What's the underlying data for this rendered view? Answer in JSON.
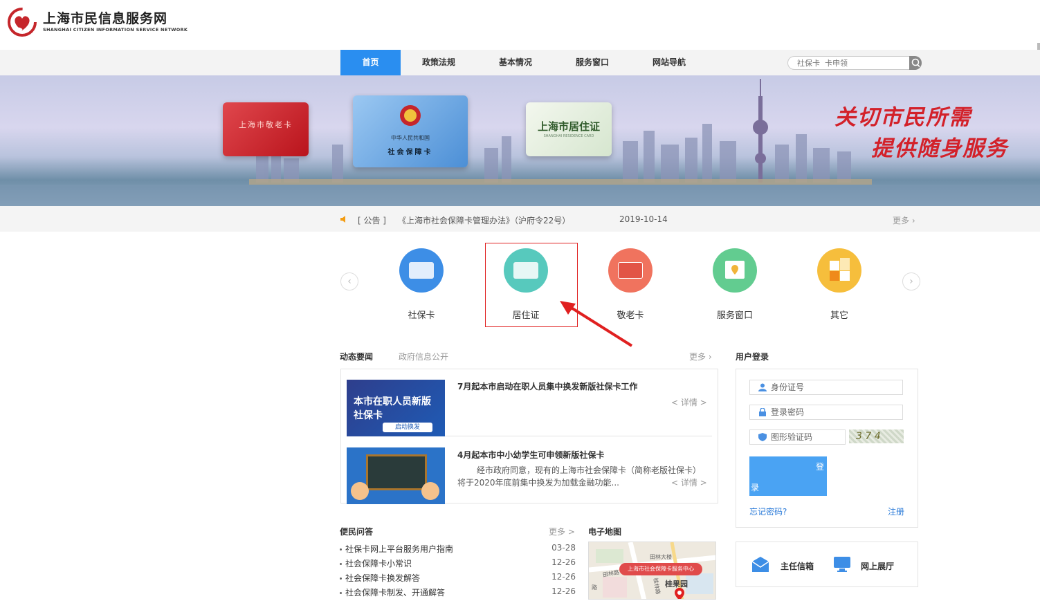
{
  "site": {
    "title": "上海市民信息服务网",
    "subtitle": "SHANGHAI CITIZEN INFORMATION SERVICE NETWORK"
  },
  "nav": {
    "items": [
      {
        "label": "首页"
      },
      {
        "label": "政策法规"
      },
      {
        "label": "基本情况"
      },
      {
        "label": "服务窗口"
      },
      {
        "label": "网站导航"
      }
    ],
    "search_placeholder": "社保卡  卡申领"
  },
  "banner": {
    "slogan_line1": "关切市民所需",
    "slogan_line2": "提供随身服务",
    "card_elder": "上海市敬老卡",
    "card_social_top": "中华人民共和国",
    "card_social": "社会保障卡",
    "card_residence": "上海市居住证",
    "card_residence_en": "SHANGHAI RESIDENCE CARD"
  },
  "notice": {
    "tag": "[ 公告 ]",
    "text": "《上海市社会保障卡管理办法》（沪府令22号）",
    "date": "2019-10-14",
    "more": "更多"
  },
  "services": [
    {
      "label": "社保卡",
      "color": "#3d8ee6"
    },
    {
      "label": "居住证",
      "color": "#57c9bd"
    },
    {
      "label": "敬老卡",
      "color": "#f0735e"
    },
    {
      "label": "服务窗口",
      "color": "#62cc90"
    },
    {
      "label": "其它",
      "color": "#f6be3c"
    }
  ],
  "news": {
    "tab_active": "动态要闻",
    "tab_other": "政府信息公开",
    "more": "更多",
    "items": [
      {
        "title": "7月起本市启动在职人员集中换发新版社保卡工作",
        "detail": "< 详情 >",
        "img_text": "本市在职人员新版社保卡",
        "img_badge": "启动换发"
      },
      {
        "title": "4月起本市中小幼学生可申领新版社保卡",
        "summary_line1": "经市政府同意，现有的上海市社会保障卡（简称老版社保卡）",
        "summary_line2": "将于2020年底前集中换发为加载金融功能...",
        "detail": "< 详情 >"
      }
    ]
  },
  "login": {
    "title": "用户登录",
    "id_placeholder": "身份证号",
    "pwd_placeholder": "登录密码",
    "captcha_placeholder": "图形验证码",
    "captcha_text": "3 7 4",
    "submit_line1": "登",
    "submit_line2": "录",
    "forgot": "忘记密码?",
    "register": "注册"
  },
  "qa": {
    "title": "便民问答",
    "more": "更多 >",
    "items": [
      {
        "text": "社保卡网上平台服务用户指南",
        "date": "03-28"
      },
      {
        "text": "社会保障卡小常识",
        "date": "12-26"
      },
      {
        "text": "社会保障卡换发解答",
        "date": "12-26"
      },
      {
        "text": "社会保障卡制发、开通解答",
        "date": "12-26"
      }
    ]
  },
  "map": {
    "title": "电子地图",
    "label": "上海市社会保障卡服务中心",
    "road1": "田林大楼",
    "road2": "田林路",
    "road3": "桂果园",
    "road4": "桂林路",
    "road5": "路"
  },
  "quick": {
    "mailbox": "主任信箱",
    "hall": "网上展厅"
  }
}
